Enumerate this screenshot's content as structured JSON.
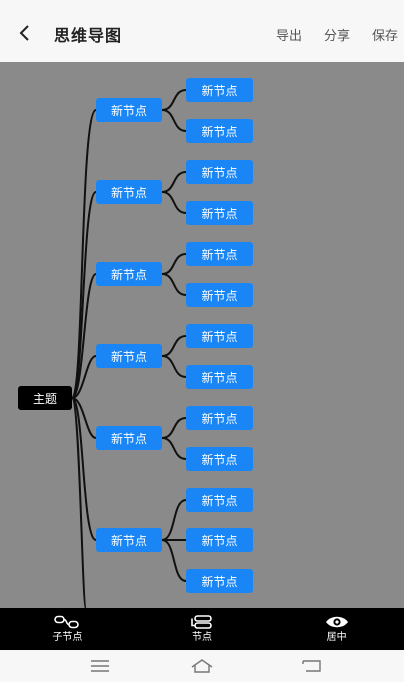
{
  "header": {
    "title": "思维导图",
    "actions": [
      "导出",
      "分享",
      "保存"
    ]
  },
  "mindmap": {
    "root": "主题",
    "branches": [
      {
        "label": "新节点",
        "children": [
          "新节点",
          "新节点"
        ]
      },
      {
        "label": "新节点",
        "children": [
          "新节点",
          "新节点"
        ]
      },
      {
        "label": "新节点",
        "children": [
          "新节点",
          "新节点"
        ]
      },
      {
        "label": "新节点",
        "children": [
          "新节点",
          "新节点"
        ]
      },
      {
        "label": "新节点",
        "children": [
          "新节点",
          "新节点"
        ]
      },
      {
        "label": "新节点",
        "children": [
          "新节点",
          "新节点",
          "新节点"
        ]
      }
    ]
  },
  "toolbar": {
    "items": [
      {
        "label": "子节点",
        "icon": "child-node-icon"
      },
      {
        "label": "节点",
        "icon": "sibling-node-icon"
      },
      {
        "label": "居中",
        "icon": "eye-icon"
      }
    ]
  },
  "colors": {
    "node": "#1a86f5",
    "root": "#000000",
    "canvas": "#8a8a8a",
    "toolbar": "#000000"
  }
}
